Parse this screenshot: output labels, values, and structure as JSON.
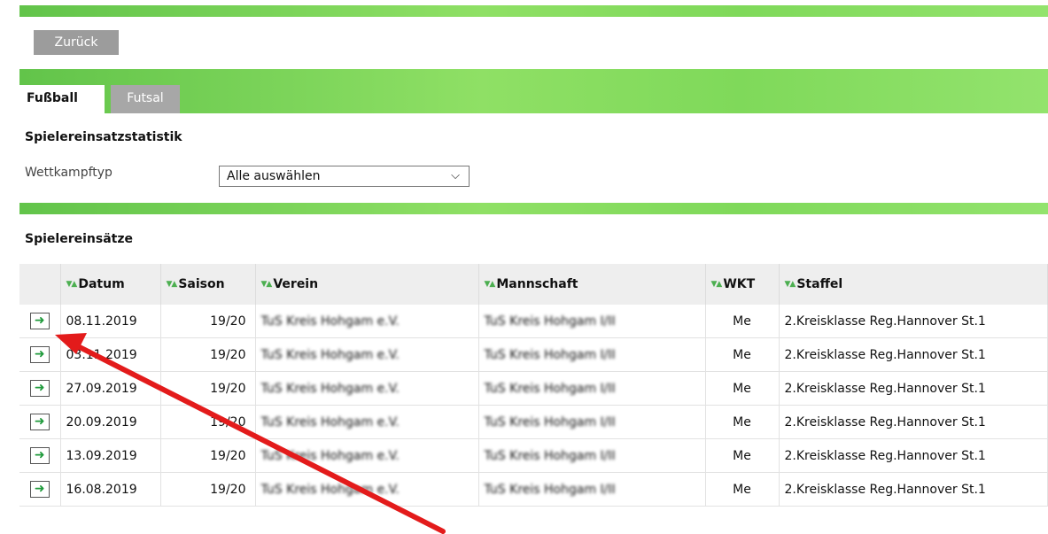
{
  "toolbar": {
    "back_label": "Zurück"
  },
  "tabs": [
    {
      "label": "Fußball",
      "active": true
    },
    {
      "label": "Futsal",
      "active": false
    }
  ],
  "statistik": {
    "title": "Spielereinsatzstatistik",
    "wettkampftyp_label": "Wettkampftyp",
    "wettkampftyp_value": "Alle auswählen"
  },
  "einsaetze": {
    "title": "Spielereinsätze",
    "columns": [
      "Datum",
      "Saison",
      "Verein",
      "Mannschaft",
      "WKT",
      "Staffel"
    ],
    "rows": [
      {
        "datum": "08.11.2019",
        "saison": "19/20",
        "verein": "TuS Kreis Hohgam e.V.",
        "mannschaft": "TuS Kreis Hohgam I/II",
        "wkt": "Me",
        "staffel": "2.Kreisklasse Reg.Hannover St.1"
      },
      {
        "datum": "03.11.2019",
        "saison": "19/20",
        "verein": "TuS Kreis Hohgam e.V.",
        "mannschaft": "TuS Kreis Hohgam I/II",
        "wkt": "Me",
        "staffel": "2.Kreisklasse Reg.Hannover St.1"
      },
      {
        "datum": "27.09.2019",
        "saison": "19/20",
        "verein": "TuS Kreis Hohgam e.V.",
        "mannschaft": "TuS Kreis Hohgam I/II",
        "wkt": "Me",
        "staffel": "2.Kreisklasse Reg.Hannover St.1"
      },
      {
        "datum": "20.09.2019",
        "saison": "19/20",
        "verein": "TuS Kreis Hohgam e.V.",
        "mannschaft": "TuS Kreis Hohgam I/II",
        "wkt": "Me",
        "staffel": "2.Kreisklasse Reg.Hannover St.1"
      },
      {
        "datum": "13.09.2019",
        "saison": "19/20",
        "verein": "TuS Kreis Hohgam e.V.",
        "mannschaft": "TuS Kreis Hohgam I/II",
        "wkt": "Me",
        "staffel": "2.Kreisklasse Reg.Hannover St.1"
      },
      {
        "datum": "16.08.2019",
        "saison": "19/20",
        "verein": "TuS Kreis Hohgam e.V.",
        "mannschaft": "TuS Kreis Hohgam I/II",
        "wkt": "Me",
        "staffel": "2.Kreisklasse Reg.Hannover St.1"
      }
    ]
  },
  "icons": {
    "go": "arrow-right-icon",
    "sort": "sort-icon",
    "select": "chevron-down-icon",
    "annotation": "red-arrow-annotation"
  },
  "colors": {
    "accent_green": "#7fd95a",
    "annotation_red": "#e31b1b",
    "button_gray": "#9c9c9c"
  }
}
